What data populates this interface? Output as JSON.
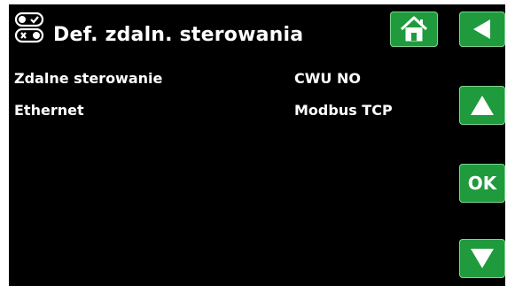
{
  "header": {
    "title": "Def. zdaln. sterowania",
    "header_icon": "remote-control-toggle-icon"
  },
  "buttons": {
    "home_icon": "home-icon",
    "back_icon": "back-arrow-icon",
    "up_icon": "up-arrow-icon",
    "ok_label": "OK",
    "down_icon": "down-arrow-icon"
  },
  "rows": [
    {
      "label": "Zdalne sterowanie",
      "value": "CWU NO"
    },
    {
      "label": "Ethernet",
      "value": "Modbus TCP"
    }
  ],
  "colors": {
    "background": "#000000",
    "button": "#1f9a3c",
    "text": "#ffffff"
  }
}
